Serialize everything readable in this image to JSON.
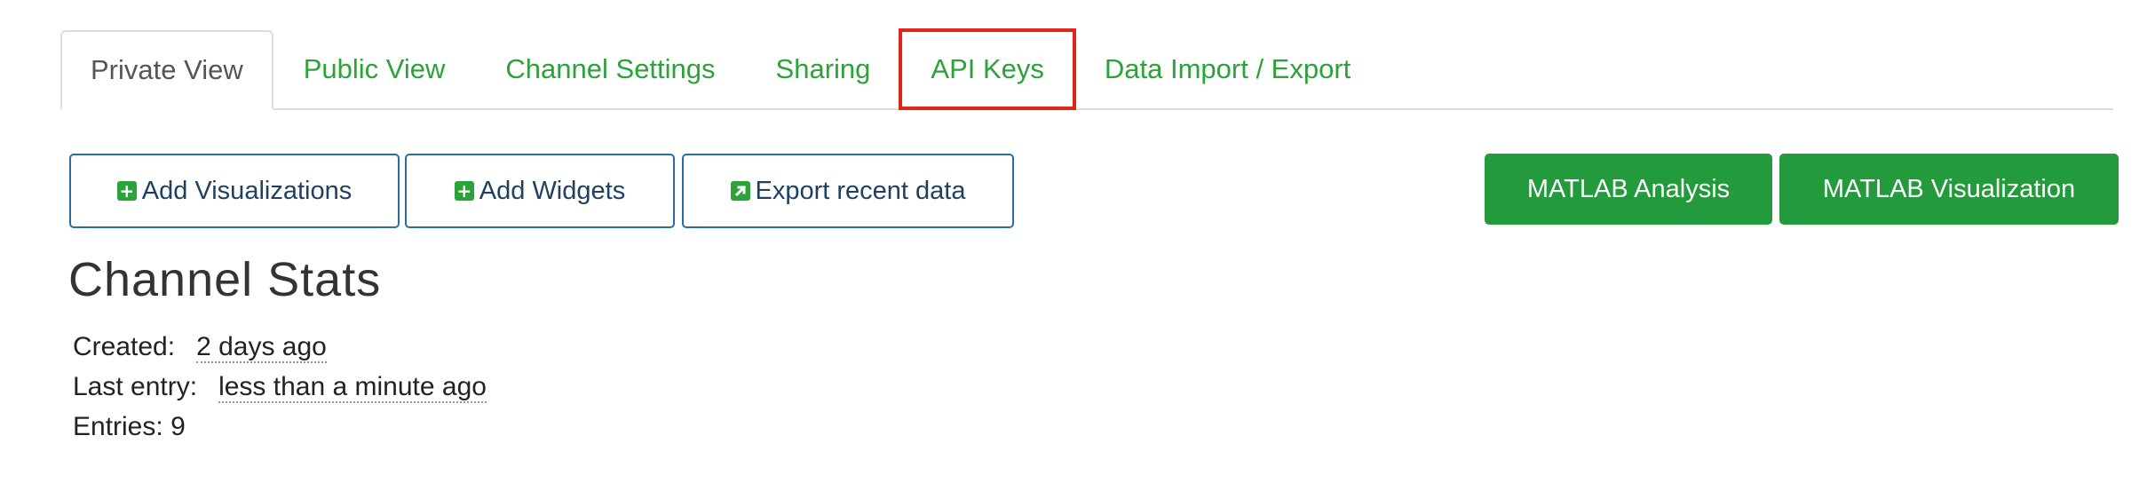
{
  "tabs": [
    {
      "label": "Private View",
      "active": true,
      "highlighted": false
    },
    {
      "label": "Public View",
      "active": false,
      "highlighted": false
    },
    {
      "label": "Channel Settings",
      "active": false,
      "highlighted": false
    },
    {
      "label": "Sharing",
      "active": false,
      "highlighted": false
    },
    {
      "label": "API Keys",
      "active": false,
      "highlighted": true
    },
    {
      "label": "Data Import / Export",
      "active": false,
      "highlighted": false
    }
  ],
  "toolbar": {
    "add_visualizations": {
      "label": "Add Visualizations",
      "icon": "plus-square-icon"
    },
    "add_widgets": {
      "label": "Add Widgets",
      "icon": "plus-square-icon"
    },
    "export_recent_data": {
      "label": "Export recent data",
      "icon": "external-link-square-icon"
    },
    "matlab_analysis": {
      "label": "MATLAB Analysis"
    },
    "matlab_visualization": {
      "label": "MATLAB Visualization"
    }
  },
  "stats": {
    "title": "Channel Stats",
    "created_label": "Created:",
    "created_value": "2 days ago",
    "last_entry_label": "Last entry:",
    "last_entry_value": "less than a minute ago",
    "entries_label": "Entries:",
    "entries_value": "9"
  },
  "colors": {
    "tab_link": "#2ca33a",
    "primary_green": "#239a3b",
    "outline_blue": "#2a6da5",
    "highlight_red": "#e0261b"
  }
}
